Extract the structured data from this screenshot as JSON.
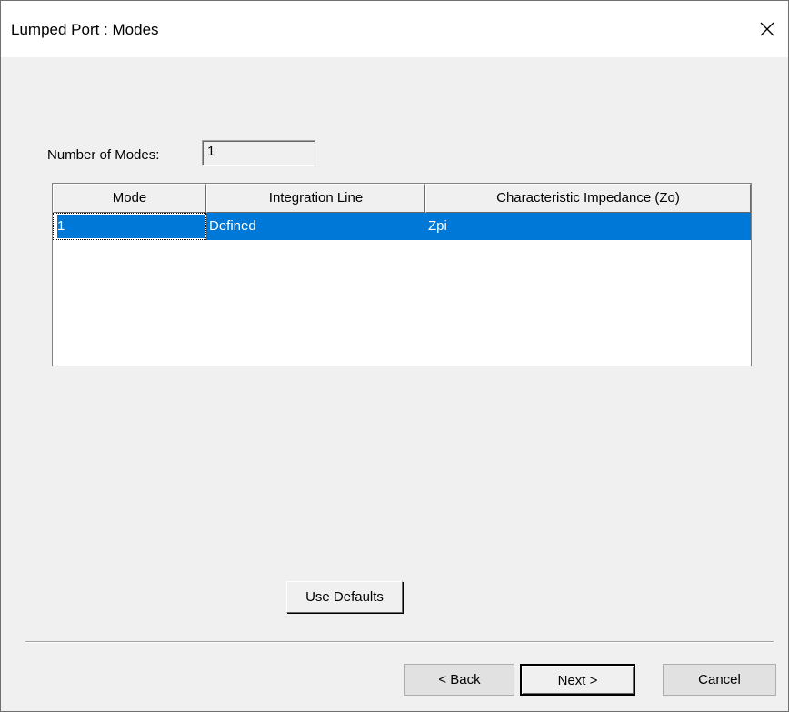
{
  "window": {
    "title": "Lumped Port : Modes",
    "close_glyph": "✕"
  },
  "modes": {
    "label": "Number of Modes:",
    "value": "1"
  },
  "table": {
    "columns": [
      "Mode",
      "Integration Line",
      "Characteristic Impedance (Zo)"
    ],
    "rows": [
      {
        "mode": "1",
        "integration_line": "Defined",
        "impedance": "Zpi",
        "selected": true
      }
    ]
  },
  "buttons": {
    "use_defaults": "Use Defaults",
    "back": "< Back",
    "next": "Next >",
    "cancel": "Cancel"
  },
  "colors": {
    "selection": "#0078d7",
    "dialog_background": "#f0f0f0"
  }
}
